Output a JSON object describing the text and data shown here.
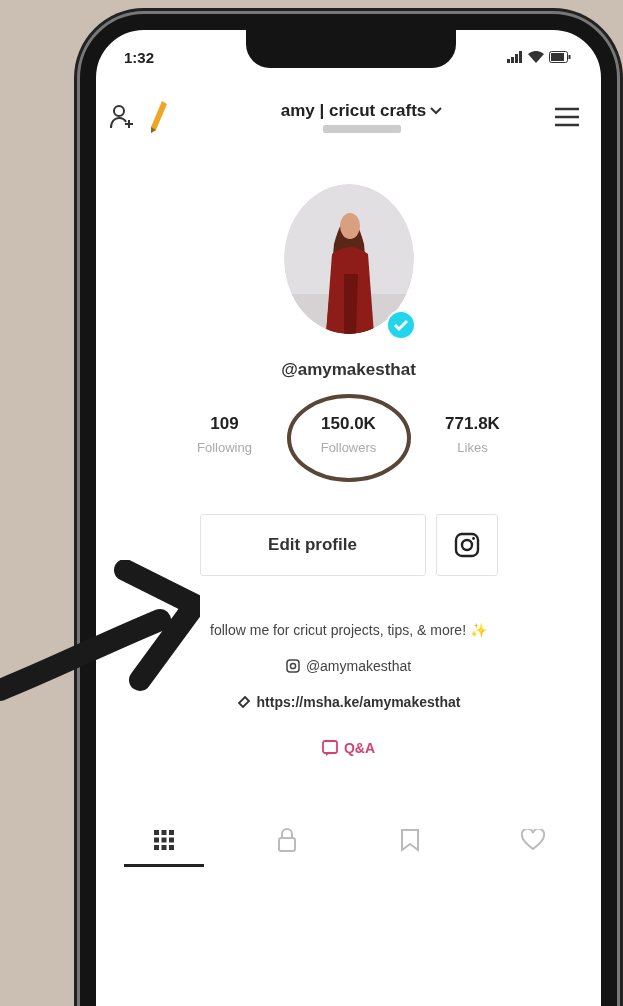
{
  "status_bar": {
    "time": "1:32"
  },
  "header": {
    "display_name": "amy | cricut crafts"
  },
  "profile": {
    "username": "@amymakesthat",
    "verified": true
  },
  "stats": [
    {
      "value": "109",
      "label": "Following",
      "highlighted": false
    },
    {
      "value": "150.0K",
      "label": "Followers",
      "highlighted": true
    },
    {
      "value": "771.8K",
      "label": "Likes",
      "highlighted": false
    }
  ],
  "actions": [
    {
      "kind": "button",
      "label": "Edit profile"
    },
    {
      "kind": "instagram"
    }
  ],
  "bio": {
    "text": "follow me for cricut projects, tips, & more! ✨",
    "instagram": "@amymakesthat",
    "link": "https://msha.ke/amymakesthat",
    "qa": "Q&A"
  },
  "tabs": [
    {
      "kind": "grid",
      "selected": true
    },
    {
      "kind": "lock",
      "selected": false
    },
    {
      "kind": "saved",
      "selected": false
    },
    {
      "kind": "liked",
      "selected": false
    }
  ]
}
